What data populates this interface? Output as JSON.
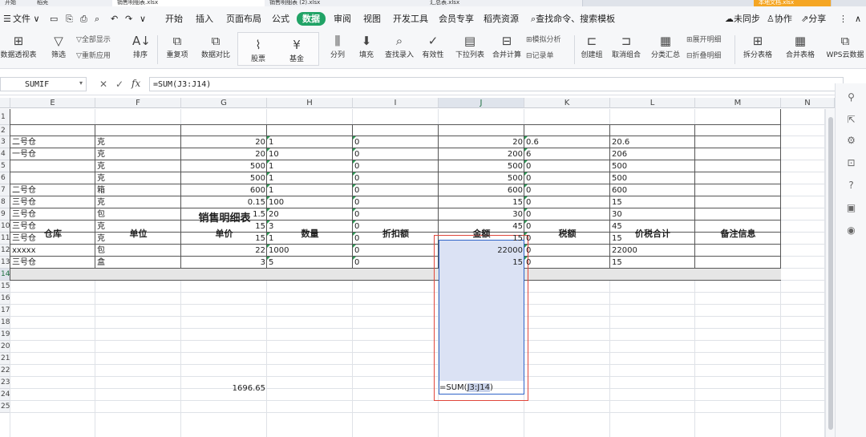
{
  "title_tabs": [
    "开始",
    "稻壳",
    "销售明细表.xlsx",
    "销售明细表 (2).xlsx",
    "汇总表.xlsx",
    "本地文档.xlsx"
  ],
  "menu": {
    "file": "文件",
    "tabs": [
      "开始",
      "插入",
      "页面布局",
      "公式",
      "数据",
      "审阅",
      "视图",
      "开发工具",
      "会员专享",
      "稻壳资源"
    ],
    "active_tab": "数据",
    "search": "查找命令、搜索模板",
    "unsynced": "未同步",
    "collab": "协作",
    "share": "分享"
  },
  "ribbon": {
    "pivot": "数据透视表",
    "filter": "筛选",
    "show_all": "全部显示",
    "reapply": "重新应用",
    "sort": "排序",
    "duplicates": "重复项",
    "compare": "数据对比",
    "stock": "股票",
    "fund": "基金",
    "split_col": "分列",
    "fill": "填充",
    "find_entry": "查找录入",
    "validity": "有效性",
    "dropdown": "下拉列表",
    "consolidate": "合并计算",
    "simulate": "模拟分析",
    "record": "记录单",
    "group": "创建组",
    "ungroup": "取消组合",
    "subtotal": "分类汇总",
    "expand": "展开明细",
    "collapse": "折叠明细",
    "split_table": "拆分表格",
    "merge_table": "合并表格",
    "wps_cloud": "WPS云数据"
  },
  "formula_bar": {
    "name_box": "SUMIF",
    "fx": "fx",
    "formula": "=SUM(J3:J14)"
  },
  "sheet": {
    "columns": [
      "E",
      "F",
      "G",
      "H",
      "I",
      "J",
      "K",
      "L",
      "M",
      "N"
    ],
    "selected_column": "J",
    "rows": [
      "1",
      "2",
      "3",
      "4",
      "5",
      "6",
      "7",
      "8",
      "9",
      "10",
      "11",
      "12",
      "13",
      "14",
      "15",
      "16",
      "17",
      "18",
      "19",
      "20",
      "21",
      "22",
      "23",
      "24",
      "25"
    ],
    "selected_row": "14",
    "table_title": "销售明细表",
    "headers": [
      "仓库",
      "单位",
      "单价",
      "数量",
      "折扣额",
      "金额",
      "税额",
      "价税合计",
      "备注信息"
    ],
    "data": [
      [
        "二号仓",
        "克",
        "20",
        "1",
        "0",
        "20",
        "0.6",
        "20.6",
        ""
      ],
      [
        "一号仓",
        "克",
        "20",
        "10",
        "0",
        "200",
        "6",
        "206",
        ""
      ],
      [
        "",
        "克",
        "500",
        "1",
        "0",
        "500",
        "0",
        "500",
        ""
      ],
      [
        "",
        "克",
        "500",
        "1",
        "0",
        "500",
        "0",
        "500",
        ""
      ],
      [
        "二号仓",
        "箱",
        "600",
        "1",
        "0",
        "600",
        "0",
        "600",
        ""
      ],
      [
        "三号仓",
        "克",
        "0.15",
        "100",
        "0",
        "15",
        "0",
        "15",
        ""
      ],
      [
        "三号仓",
        "包",
        "1.5",
        "20",
        "0",
        "30",
        "0",
        "30",
        ""
      ],
      [
        "三号仓",
        "克",
        "15",
        "3",
        "0",
        "45",
        "0",
        "45",
        ""
      ],
      [
        "三号仓",
        "克",
        "15",
        "1",
        "0",
        "15",
        "0",
        "15",
        ""
      ],
      [
        "xxxxx",
        "包",
        "22",
        "1000",
        "0",
        "22000",
        "0",
        "22000",
        ""
      ],
      [
        "三号仓",
        "盒",
        "3",
        "5",
        "0",
        "15",
        "0",
        "15",
        ""
      ]
    ],
    "total_row": {
      "unit_price_total": "1696.65",
      "amount_formula_prefix": "=SUM(",
      "amount_formula_ref": "J3:J14",
      "amount_formula_suffix": ")"
    }
  },
  "colors": {
    "accent_green": "#21a366",
    "selection_fill": "#dbe2f4",
    "selection_border": "#2f64c8",
    "highlight_red": "#e0463c"
  }
}
